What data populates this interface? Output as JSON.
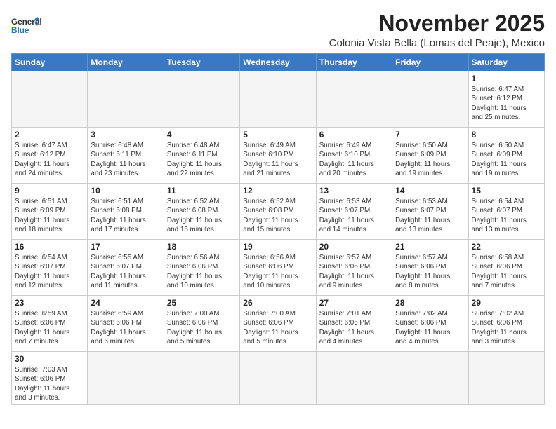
{
  "header": {
    "logo_general": "General",
    "logo_blue": "Blue",
    "month_title": "November 2025",
    "subtitle": "Colonia Vista Bella (Lomas del Peaje), Mexico"
  },
  "days_of_week": [
    "Sunday",
    "Monday",
    "Tuesday",
    "Wednesday",
    "Thursday",
    "Friday",
    "Saturday"
  ],
  "weeks": [
    [
      {
        "day": "",
        "info": ""
      },
      {
        "day": "",
        "info": ""
      },
      {
        "day": "",
        "info": ""
      },
      {
        "day": "",
        "info": ""
      },
      {
        "day": "",
        "info": ""
      },
      {
        "day": "",
        "info": ""
      },
      {
        "day": "1",
        "info": "Sunrise: 6:47 AM\nSunset: 6:12 PM\nDaylight: 11 hours\nand 25 minutes."
      }
    ],
    [
      {
        "day": "2",
        "info": "Sunrise: 6:47 AM\nSunset: 6:12 PM\nDaylight: 11 hours\nand 24 minutes."
      },
      {
        "day": "3",
        "info": "Sunrise: 6:48 AM\nSunset: 6:11 PM\nDaylight: 11 hours\nand 23 minutes."
      },
      {
        "day": "4",
        "info": "Sunrise: 6:48 AM\nSunset: 6:11 PM\nDaylight: 11 hours\nand 22 minutes."
      },
      {
        "day": "5",
        "info": "Sunrise: 6:49 AM\nSunset: 6:10 PM\nDaylight: 11 hours\nand 21 minutes."
      },
      {
        "day": "6",
        "info": "Sunrise: 6:49 AM\nSunset: 6:10 PM\nDaylight: 11 hours\nand 20 minutes."
      },
      {
        "day": "7",
        "info": "Sunrise: 6:50 AM\nSunset: 6:09 PM\nDaylight: 11 hours\nand 19 minutes."
      },
      {
        "day": "8",
        "info": "Sunrise: 6:50 AM\nSunset: 6:09 PM\nDaylight: 11 hours\nand 19 minutes."
      }
    ],
    [
      {
        "day": "9",
        "info": "Sunrise: 6:51 AM\nSunset: 6:09 PM\nDaylight: 11 hours\nand 18 minutes."
      },
      {
        "day": "10",
        "info": "Sunrise: 6:51 AM\nSunset: 6:08 PM\nDaylight: 11 hours\nand 17 minutes."
      },
      {
        "day": "11",
        "info": "Sunrise: 6:52 AM\nSunset: 6:08 PM\nDaylight: 11 hours\nand 16 minutes."
      },
      {
        "day": "12",
        "info": "Sunrise: 6:52 AM\nSunset: 6:08 PM\nDaylight: 11 hours\nand 15 minutes."
      },
      {
        "day": "13",
        "info": "Sunrise: 6:53 AM\nSunset: 6:07 PM\nDaylight: 11 hours\nand 14 minutes."
      },
      {
        "day": "14",
        "info": "Sunrise: 6:53 AM\nSunset: 6:07 PM\nDaylight: 11 hours\nand 13 minutes."
      },
      {
        "day": "15",
        "info": "Sunrise: 6:54 AM\nSunset: 6:07 PM\nDaylight: 11 hours\nand 13 minutes."
      }
    ],
    [
      {
        "day": "16",
        "info": "Sunrise: 6:54 AM\nSunset: 6:07 PM\nDaylight: 11 hours\nand 12 minutes."
      },
      {
        "day": "17",
        "info": "Sunrise: 6:55 AM\nSunset: 6:07 PM\nDaylight: 11 hours\nand 11 minutes."
      },
      {
        "day": "18",
        "info": "Sunrise: 6:56 AM\nSunset: 6:06 PM\nDaylight: 11 hours\nand 10 minutes."
      },
      {
        "day": "19",
        "info": "Sunrise: 6:56 AM\nSunset: 6:06 PM\nDaylight: 11 hours\nand 10 minutes."
      },
      {
        "day": "20",
        "info": "Sunrise: 6:57 AM\nSunset: 6:06 PM\nDaylight: 11 hours\nand 9 minutes."
      },
      {
        "day": "21",
        "info": "Sunrise: 6:57 AM\nSunset: 6:06 PM\nDaylight: 11 hours\nand 8 minutes."
      },
      {
        "day": "22",
        "info": "Sunrise: 6:58 AM\nSunset: 6:06 PM\nDaylight: 11 hours\nand 7 minutes."
      }
    ],
    [
      {
        "day": "23",
        "info": "Sunrise: 6:59 AM\nSunset: 6:06 PM\nDaylight: 11 hours\nand 7 minutes."
      },
      {
        "day": "24",
        "info": "Sunrise: 6:59 AM\nSunset: 6:06 PM\nDaylight: 11 hours\nand 6 minutes."
      },
      {
        "day": "25",
        "info": "Sunrise: 7:00 AM\nSunset: 6:06 PM\nDaylight: 11 hours\nand 5 minutes."
      },
      {
        "day": "26",
        "info": "Sunrise: 7:00 AM\nSunset: 6:06 PM\nDaylight: 11 hours\nand 5 minutes."
      },
      {
        "day": "27",
        "info": "Sunrise: 7:01 AM\nSunset: 6:06 PM\nDaylight: 11 hours\nand 4 minutes."
      },
      {
        "day": "28",
        "info": "Sunrise: 7:02 AM\nSunset: 6:06 PM\nDaylight: 11 hours\nand 4 minutes."
      },
      {
        "day": "29",
        "info": "Sunrise: 7:02 AM\nSunset: 6:06 PM\nDaylight: 11 hours\nand 3 minutes."
      }
    ],
    [
      {
        "day": "30",
        "info": "Sunrise: 7:03 AM\nSunset: 6:06 PM\nDaylight: 11 hours\nand 3 minutes."
      },
      {
        "day": "",
        "info": ""
      },
      {
        "day": "",
        "info": ""
      },
      {
        "day": "",
        "info": ""
      },
      {
        "day": "",
        "info": ""
      },
      {
        "day": "",
        "info": ""
      },
      {
        "day": "",
        "info": ""
      }
    ]
  ]
}
